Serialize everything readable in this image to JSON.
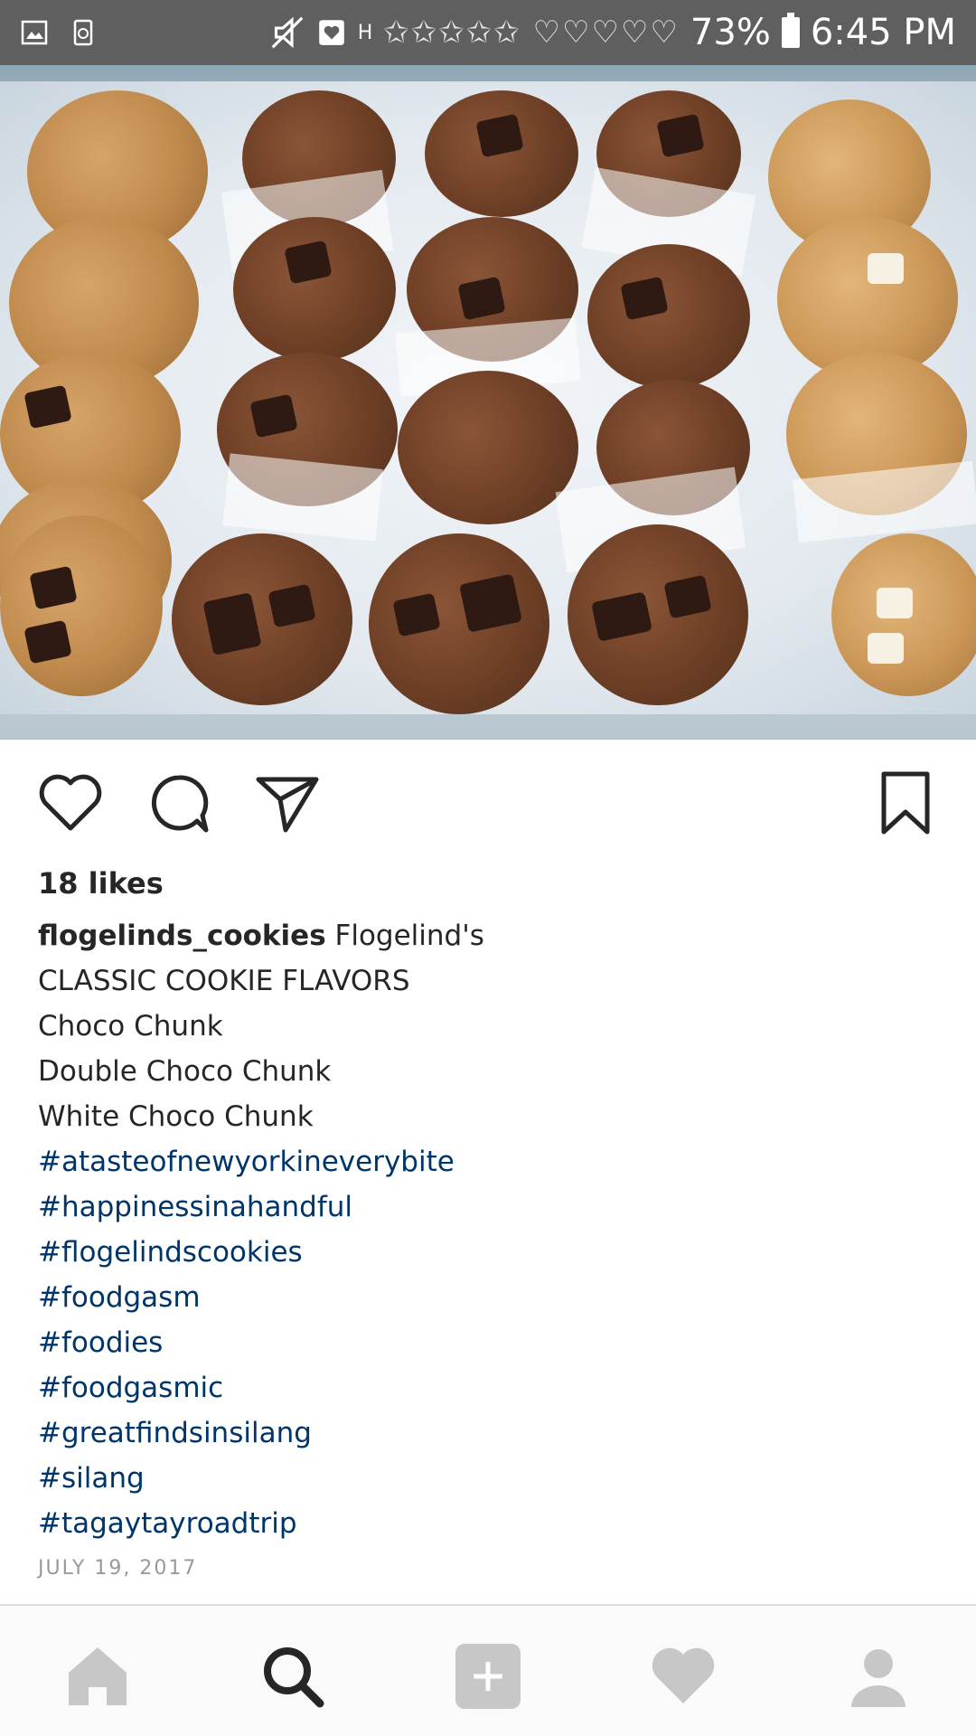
{
  "status_bar": {
    "time": "6:45 PM",
    "battery": "73%",
    "notification_glyphs": "✩✩✩✩✩ ♡♡♡♡♡",
    "network": "H"
  },
  "post": {
    "likes": "18 likes",
    "username": "flogelinds_cookies",
    "caption_lines": [
      "Flogelind's",
      "CLASSIC COOKIE FLAVORS",
      "Choco Chunk",
      "Double Choco Chunk",
      "White Choco Chunk"
    ],
    "hashtags": [
      "#atasteofnewyorkineverybite",
      "#happinessinahandful",
      "#flogelindscookies",
      "#foodgasm",
      "#foodies",
      "#foodgasmic",
      "#greatfindsinsilang",
      "#silang",
      "#tagaytayroadtrip"
    ],
    "date": "JULY 19, 2017"
  },
  "actions": {
    "like": "heart-icon",
    "comment": "comment-icon",
    "share": "send-icon",
    "save": "bookmark-icon"
  },
  "bottom_nav": [
    "home-icon",
    "search-icon",
    "add-icon",
    "activity-icon",
    "profile-icon"
  ],
  "colors": {
    "status_bar": "#5f5f5f",
    "text": "#262626",
    "hashtag": "#003569",
    "date": "#999999",
    "nav_inactive": "#c7c7c7",
    "nav_active": "#262626"
  }
}
